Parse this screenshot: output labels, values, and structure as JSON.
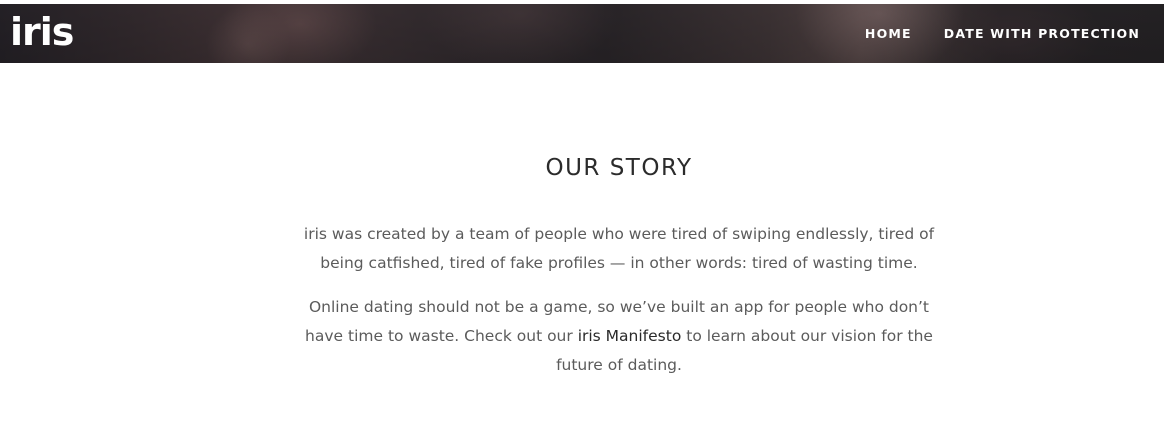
{
  "header": {
    "logo_text": "iris",
    "nav": [
      {
        "label": "HOME"
      },
      {
        "label": "DATE WITH PROTECTION"
      }
    ]
  },
  "main": {
    "title": "OUR STORY",
    "paragraph_1": "iris was created by a team of people who were tired of swiping endlessly, tired of being catfished, tired of fake profiles — in other words: tired of wasting time.",
    "paragraph_2": {
      "before_link": "Online dating should not be a game, so we’ve built an app for people who don’t have time to waste. Check out our ",
      "link_text": "iris Manifesto",
      "after_link": " to learn about our vision for the future of dating."
    }
  },
  "colors": {
    "header_bg": "#2f2a2e",
    "nav_text": "#ffffff",
    "title_text": "#2b2b2b",
    "body_text": "#5b5b5b",
    "link_text": "#2a2a2a"
  }
}
